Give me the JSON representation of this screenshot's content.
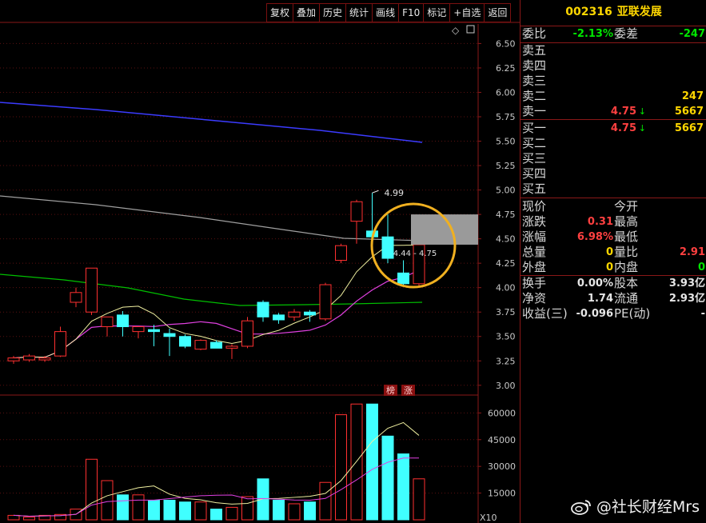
{
  "toolbar": [
    {
      "label": "复权",
      "name": "fuquan-button"
    },
    {
      "label": "叠加",
      "name": "overlay-button"
    },
    {
      "label": "历史",
      "name": "history-button"
    },
    {
      "label": "统计",
      "name": "stats-button"
    },
    {
      "label": "画线",
      "name": "draw-line-button"
    },
    {
      "label": "F10",
      "name": "f10-button"
    },
    {
      "label": "标记",
      "name": "mark-button"
    },
    {
      "label": "+自选",
      "name": "add-watchlist-button"
    },
    {
      "label": "返回",
      "name": "back-button"
    }
  ],
  "quote": {
    "code": "002316",
    "name": "亚联发展",
    "weibi_label": "委比",
    "weibi": "-2.13%",
    "weicha_label": "委差",
    "weicha": "-247",
    "sell": [
      {
        "label": "卖五",
        "price": "",
        "vol": ""
      },
      {
        "label": "卖四",
        "price": "",
        "vol": ""
      },
      {
        "label": "卖三",
        "price": "",
        "vol": ""
      },
      {
        "label": "卖二",
        "price": "",
        "vol": "247"
      },
      {
        "label": "卖一",
        "price": "4.75",
        "vol": "5667"
      }
    ],
    "buy": [
      {
        "label": "买一",
        "price": "4.75",
        "vol": "5667"
      },
      {
        "label": "买二",
        "price": "",
        "vol": ""
      },
      {
        "label": "买三",
        "price": "",
        "vol": ""
      },
      {
        "label": "买四",
        "price": "",
        "vol": ""
      },
      {
        "label": "买五",
        "price": "",
        "vol": ""
      }
    ],
    "stats1": [
      {
        "l1": "现价",
        "v1": "",
        "l2": "今开",
        "v2": ""
      },
      {
        "l1": "涨跌",
        "v1": "0.31",
        "l2": "最高",
        "v2": ""
      },
      {
        "l1": "涨幅",
        "v1": "6.98%",
        "l2": "最低",
        "v2": ""
      },
      {
        "l1": "总量",
        "v1": "0",
        "l2": "量比",
        "v2": "2.91"
      },
      {
        "l1": "外盘",
        "v1": "0",
        "l2": "内盘",
        "v2": "0"
      }
    ],
    "stats2": [
      {
        "l1": "换手",
        "v1": "0.00%",
        "l2": "股本",
        "v2": "3.93亿"
      },
      {
        "l1": "净资",
        "v1": "1.74",
        "l2": "流通",
        "v2": "2.93亿"
      },
      {
        "l1": "收益(三)",
        "v1": "-0.096",
        "l2": "PE(动)",
        "v2": "-"
      }
    ],
    "colors": {
      "up": "#ff4040",
      "down": "#00e600",
      "vol": "#ffd700"
    }
  },
  "chart_data": [
    {
      "type": "candlestick",
      "y_ticks": [
        "6.50",
        "6.25",
        "6.00",
        "5.75",
        "5.50",
        "5.25",
        "5.00",
        "4.75",
        "4.50",
        "4.25",
        "4.00",
        "3.75",
        "3.50",
        "3.25",
        "3.00"
      ],
      "ylim": [
        2.9,
        6.7
      ],
      "candles": [
        {
          "o": 3.25,
          "h": 3.3,
          "l": 3.22,
          "c": 3.28
        },
        {
          "o": 3.26,
          "h": 3.32,
          "l": 3.24,
          "c": 3.3
        },
        {
          "o": 3.26,
          "h": 3.3,
          "l": 3.24,
          "c": 3.28
        },
        {
          "o": 3.3,
          "h": 3.6,
          "l": 3.29,
          "c": 3.55
        },
        {
          "o": 3.85,
          "h": 4.0,
          "l": 3.8,
          "c": 3.95
        },
        {
          "o": 3.75,
          "h": 4.2,
          "l": 3.72,
          "c": 4.2
        },
        {
          "o": 3.6,
          "h": 3.7,
          "l": 3.5,
          "c": 3.7
        },
        {
          "o": 3.72,
          "h": 3.76,
          "l": 3.5,
          "c": 3.6
        },
        {
          "o": 3.55,
          "h": 3.6,
          "l": 3.48,
          "c": 3.6
        },
        {
          "o": 3.57,
          "h": 3.62,
          "l": 3.4,
          "c": 3.55
        },
        {
          "o": 3.53,
          "h": 3.58,
          "l": 3.3,
          "c": 3.5
        },
        {
          "o": 3.5,
          "h": 3.52,
          "l": 3.38,
          "c": 3.4
        },
        {
          "o": 3.37,
          "h": 3.47,
          "l": 3.36,
          "c": 3.46
        },
        {
          "o": 3.44,
          "h": 3.46,
          "l": 3.38,
          "c": 3.38
        },
        {
          "o": 3.38,
          "h": 3.42,
          "l": 3.27,
          "c": 3.4
        },
        {
          "o": 3.4,
          "h": 3.7,
          "l": 3.38,
          "c": 3.66
        },
        {
          "o": 3.85,
          "h": 3.87,
          "l": 3.65,
          "c": 3.7
        },
        {
          "o": 3.72,
          "h": 3.74,
          "l": 3.63,
          "c": 3.67
        },
        {
          "o": 3.7,
          "h": 3.78,
          "l": 3.66,
          "c": 3.75
        },
        {
          "o": 3.75,
          "h": 3.77,
          "l": 3.65,
          "c": 3.72
        },
        {
          "o": 3.68,
          "h": 4.05,
          "l": 3.66,
          "c": 4.03
        },
        {
          "o": 4.28,
          "h": 4.45,
          "l": 4.25,
          "c": 4.43
        },
        {
          "o": 4.68,
          "h": 4.9,
          "l": 4.45,
          "c": 4.88
        },
        {
          "o": 4.58,
          "h": 4.97,
          "l": 4.5,
          "c": 4.52
        },
        {
          "o": 4.52,
          "h": 4.75,
          "l": 4.25,
          "c": 4.3
        },
        {
          "o": 4.15,
          "h": 4.28,
          "l": 4.02,
          "c": 4.04
        },
        {
          "o": 4.04,
          "h": 4.44,
          "l": 4.0,
          "c": 4.44
        }
      ],
      "annotations": {
        "high_label": "4.99",
        "range_label": "4.44 - 4.75",
        "tags": [
          "榜",
          "涨"
        ]
      }
    },
    {
      "type": "bar",
      "y_ticks": [
        "60000",
        "45000",
        "30000",
        "15000"
      ],
      "ylim": [
        0,
        66000
      ],
      "unit_label": "X10",
      "volumes": [
        2500,
        1500,
        2500,
        3000,
        6000,
        34000,
        22000,
        14000,
        14000,
        11000,
        11000,
        10000,
        10000,
        6000,
        7000,
        13000,
        23000,
        11000,
        9000,
        10000,
        21000,
        59000,
        65000,
        65000,
        47000,
        37000,
        23000
      ]
    }
  ]
}
